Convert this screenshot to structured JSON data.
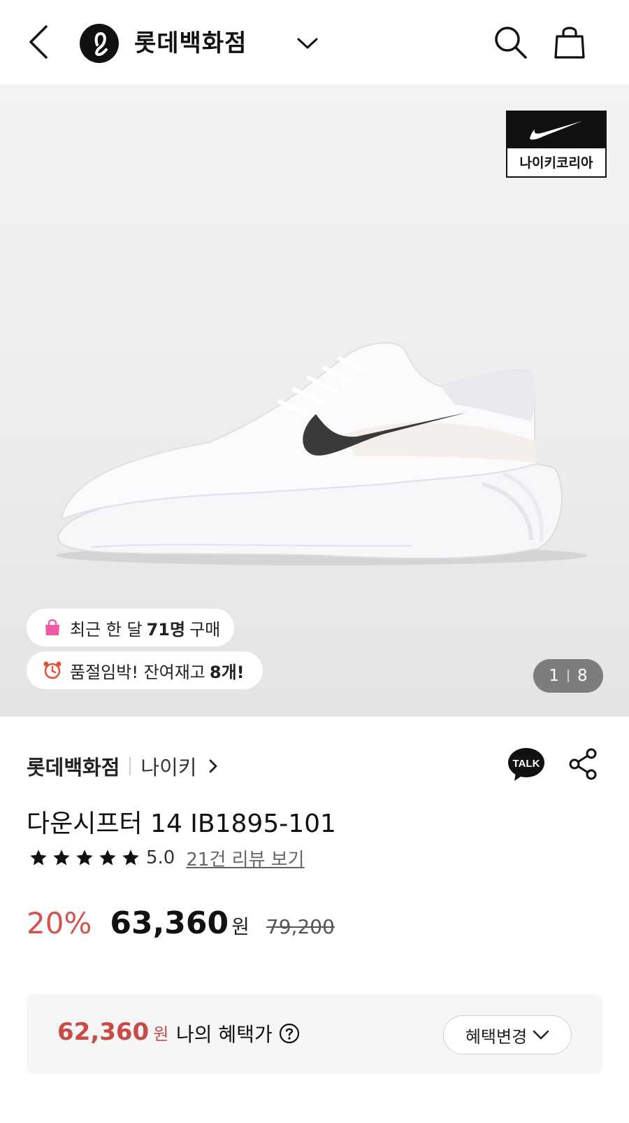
{
  "header": {
    "brand_title": "롯데백화점",
    "icons": [
      "back-arrow-icon",
      "lotte-logo-icon",
      "chevron-down-icon",
      "search-icon",
      "shopping-bag-icon"
    ]
  },
  "gallery": {
    "brand_badge": "나이키코리아",
    "recent_purchase": {
      "prefix": "최근 한 달",
      "count": "71명",
      "suffix": "구매"
    },
    "stock_alert": {
      "prefix": "품절임박! 잔여재고",
      "count": "8개!"
    },
    "counter": {
      "current": "1",
      "total": "8"
    }
  },
  "product": {
    "store": "롯데백화점",
    "brand": "나이키",
    "title": "다운시프터 14 IB1895-101",
    "rating": "5.0",
    "rating_stars": 5,
    "reviews_link": "21건 리뷰 보기",
    "discount": "20%",
    "price": "63,360",
    "currency": "원",
    "original_price": "79,200"
  },
  "benefit": {
    "amount": "62,360",
    "currency": "원",
    "label": "나의 혜택가",
    "change_button": "혜택변경"
  },
  "colors": {
    "discount": "#d2534d",
    "benefit": "#c84b45",
    "text": "#111111"
  }
}
